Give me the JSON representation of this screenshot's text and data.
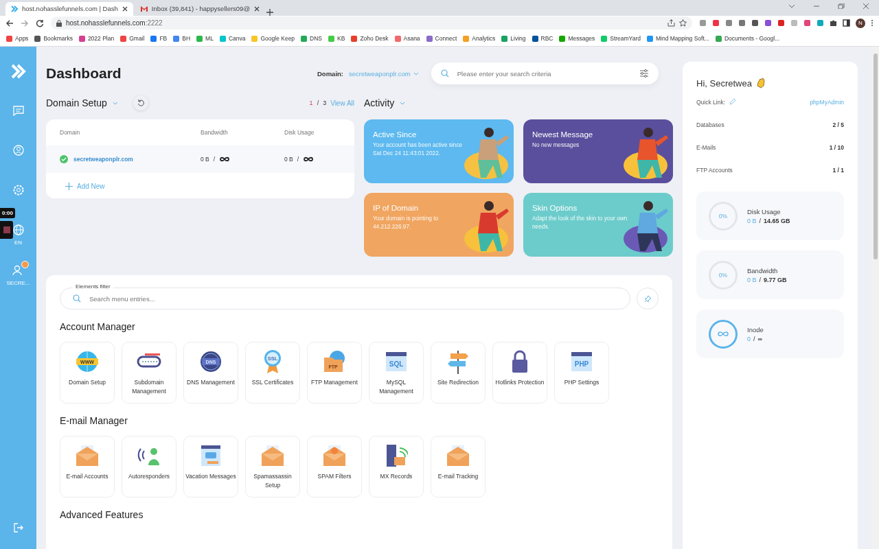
{
  "browser": {
    "tabs": [
      {
        "title": "host.nohasslefunnels.com | Dash",
        "selected": true
      },
      {
        "title": "Inbox (39,841) - happysellers09@",
        "selected": false
      }
    ],
    "url_host": "host.nohasslefunnels.com",
    "url_port": ":2222",
    "bookmarks": [
      "Apps",
      "Bookmarks",
      "2022 Plan",
      "Gmail",
      "FB",
      "BH",
      "ML",
      "Canva",
      "Google Keep",
      "DNS",
      "KB",
      "Zoho Desk",
      "Asana",
      "Connect",
      "Analytics",
      "Living",
      "RBC",
      "Messages",
      "StreamYard",
      "Mind Mapping Soft...",
      "Documents - Googl..."
    ],
    "profile_initial": "N"
  },
  "recorder": {
    "time": "0:00"
  },
  "sidebar": {
    "language": "EN",
    "user": "SECRE..."
  },
  "header": {
    "title": "Dashboard",
    "domain_label": "Domain:",
    "domain_value": "secretweaponplr.com",
    "search_placeholder": "Please enter your search criteria"
  },
  "domain_setup": {
    "separator": "/",
    "title": "Domain Setup",
    "page": "1",
    "pages": "3",
    "view_all": "View All",
    "columns": [
      "Domain",
      "Bandwidth",
      "Disk Usage"
    ],
    "rows": [
      {
        "domain": "secretweaponplr.com",
        "active": true,
        "bandwidth": "0 B",
        "disk": "0 B"
      }
    ],
    "add_new": "Add New"
  },
  "activity": {
    "title": "Activity",
    "cards": [
      {
        "title": "Active Since",
        "text": "Your account has been active since Sat Dec 24 11:43:01 2022.",
        "color": "#5db9ef"
      },
      {
        "title": "Newest Message",
        "text": "No new messages",
        "color": "#5a4f9c"
      },
      {
        "title": "IP of Domain",
        "text": "Your domain is pointing to 44.212.226.97.",
        "color": "#f0a560"
      },
      {
        "title": "Skin Options",
        "text": "Adapt the look of the skin to your own needs.",
        "color": "#6ccccb"
      }
    ]
  },
  "elements_filter": {
    "label": "Elements filter",
    "placeholder": "Search menu entries..."
  },
  "sections": [
    {
      "title": "Account Manager",
      "items": [
        {
          "label": "Domain Setup",
          "icon_text": "WWW"
        },
        {
          "label": "Subdomain Management"
        },
        {
          "label": "DNS Management",
          "icon_text": "DNS"
        },
        {
          "label": "SSL Certificates",
          "icon_text": "SSL"
        },
        {
          "label": "FTP Management",
          "icon_text": "FTP"
        },
        {
          "label": "MySQL Management",
          "icon_text": "SQL"
        },
        {
          "label": "Site Redirection"
        },
        {
          "label": "Hotlinks Protection"
        },
        {
          "label": "PHP Settings",
          "icon_text": "PHP"
        }
      ]
    },
    {
      "title": "E-mail Manager",
      "items": [
        {
          "label": "E-mail Accounts"
        },
        {
          "label": "Autoresponders"
        },
        {
          "label": "Vacation Messages"
        },
        {
          "label": "Spamassassin Setup"
        },
        {
          "label": "SPAM Filters"
        },
        {
          "label": "MX Records"
        },
        {
          "label": "E-mail Tracking"
        }
      ]
    },
    {
      "title": "Advanced Features"
    }
  ],
  "account_panel": {
    "separator": "/",
    "greeting": "Hi, Secretwea",
    "quick_link_label": "Quick Link:",
    "quick_link": "phpMyAdmin",
    "stats": [
      {
        "label": "Databases",
        "value": "2 / 5"
      },
      {
        "label": "E-Mails",
        "value": "1 / 10"
      },
      {
        "label": "FTP Accounts",
        "value": "1 / 1"
      }
    ],
    "usage": [
      {
        "kind": "percent",
        "percent": "0%",
        "label": "Disk Usage",
        "used": "0 B",
        "limit": "14.65 GB"
      },
      {
        "kind": "percent",
        "percent": "0%",
        "label": "Bandwidth",
        "used": "0 B",
        "limit": "9.77 GB"
      },
      {
        "kind": "unlimited",
        "label": "Inode",
        "used": "0",
        "limit": "∞"
      }
    ]
  }
}
